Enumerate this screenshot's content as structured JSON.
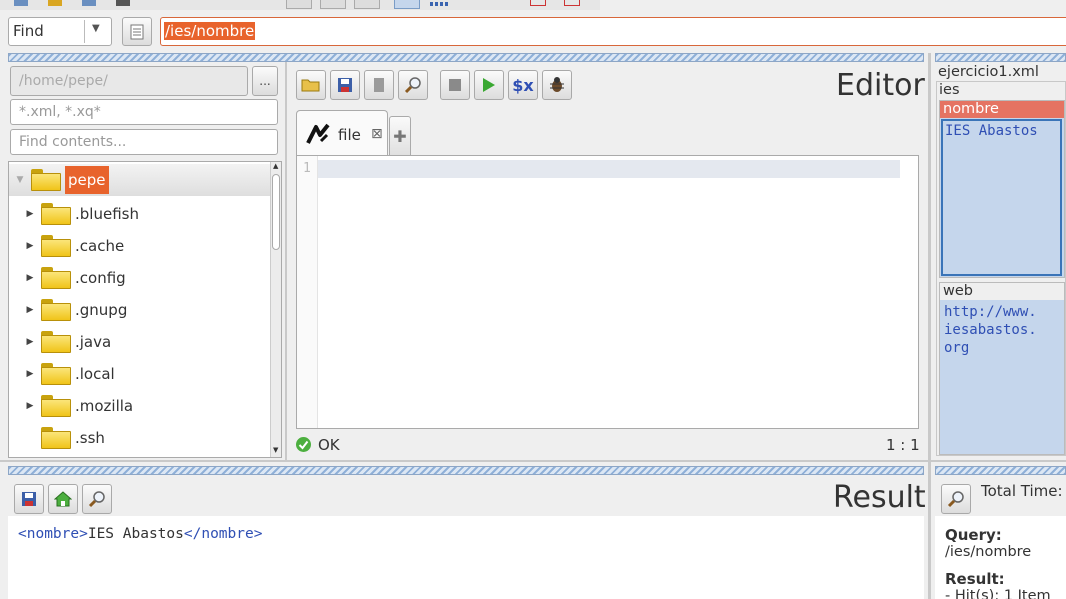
{
  "find_bar": {
    "mode": "Find",
    "query": "/ies/nombre"
  },
  "file_browser": {
    "path_placeholder": "/home/pepe/",
    "browse_label": "...",
    "filter_placeholder": "*.xml, *.xq*",
    "contents_placeholder": "Find contents...",
    "root": "pepe",
    "folders": [
      ".bluefish",
      ".cache",
      ".config",
      ".gnupg",
      ".java",
      ".local",
      ".mozilla",
      ".ssh"
    ]
  },
  "editor": {
    "title": "Editor",
    "tab_label": "file",
    "line_number": "1",
    "status": "OK",
    "position": "1 : 1"
  },
  "xml_view": {
    "file": "ejercicio1.xml",
    "root": "ies",
    "selected_element": "nombre",
    "selected_value": "IES Abastos",
    "other_element": "web",
    "other_value": "http://www.iesabastos.org",
    "other_value_lines": [
      "http://www.",
      "iesabastos.",
      "org"
    ]
  },
  "result": {
    "title": "Result",
    "open_tag": "<nombre>",
    "text": "IES Abastos",
    "close_tag": "</nombre>"
  },
  "info": {
    "total_time_label": "Total Time:",
    "query_label": "Query:",
    "query_value": "/ies/nombre",
    "result_label": "Result:",
    "result_value": "- Hit(s): 1 Item"
  },
  "colors": {
    "accent": "#e8632c",
    "selection": "#c5d6ec",
    "keyword": "#2f4fb4"
  }
}
